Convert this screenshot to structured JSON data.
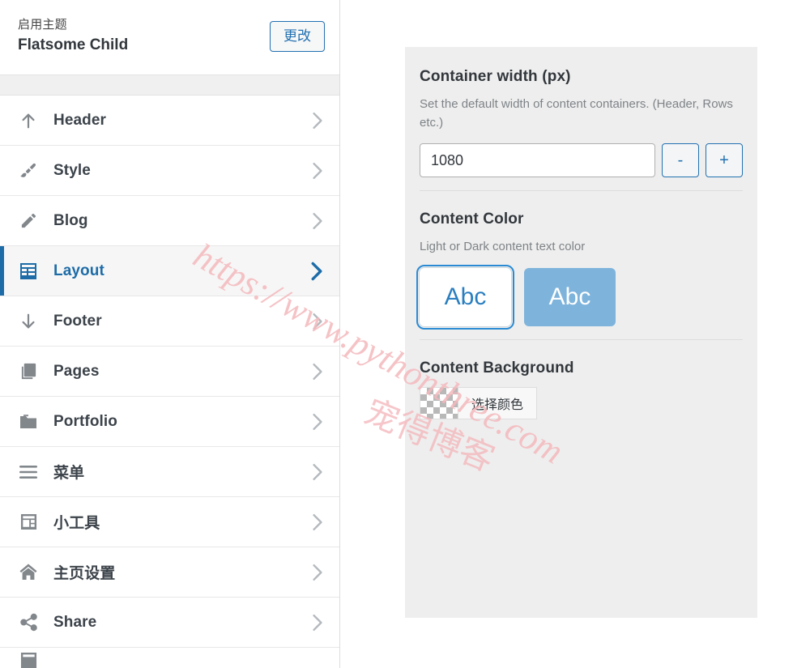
{
  "customizer": {
    "theme_header": {
      "active_label": "启用主题",
      "theme_name": "Flatsome Child",
      "change_button": "更改"
    },
    "menu_items": [
      {
        "label": "Header",
        "icon": "arrow-up-icon",
        "active": false
      },
      {
        "label": "Style",
        "icon": "paint-brush-icon",
        "active": false
      },
      {
        "label": "Blog",
        "icon": "pencil-icon",
        "active": false
      },
      {
        "label": "Layout",
        "icon": "table-grid-icon",
        "active": true
      },
      {
        "label": "Footer",
        "icon": "arrow-down-icon",
        "active": false
      },
      {
        "label": "Pages",
        "icon": "pages-stack-icon",
        "active": false
      },
      {
        "label": "Portfolio",
        "icon": "folder-icon",
        "active": false
      },
      {
        "label": "菜单",
        "icon": "hamburger-icon",
        "active": false
      },
      {
        "label": "小工具",
        "icon": "widgets-icon",
        "active": false
      },
      {
        "label": "主页设置",
        "icon": "home-icon",
        "active": false
      },
      {
        "label": "Share",
        "icon": "share-icon",
        "active": false
      }
    ]
  },
  "settings": {
    "container_width": {
      "title": "Container width (px)",
      "description": "Set the default width of content containers. (Header, Rows etc.)",
      "value": "1080",
      "decrement_label": "-",
      "increment_label": "+"
    },
    "content_color": {
      "title": "Content Color",
      "description": "Light or Dark content text color",
      "options": [
        {
          "label": "Abc",
          "variant": "light",
          "selected": true
        },
        {
          "label": "Abc",
          "variant": "dark",
          "selected": false
        }
      ]
    },
    "content_background": {
      "title": "Content Background",
      "swatch": "transparent",
      "pick_button": "选择颜色"
    }
  },
  "watermark": {
    "url": "https://www.pythonthree.com",
    "text_cn": "宠得博客"
  },
  "colors": {
    "accent_blue": "#2271b1",
    "active_blue": "#1d6ca8",
    "icon_gray": "#82878c",
    "panel_bg": "#eeeeee",
    "swatch_dark": "#7eb4dc",
    "watermark_pink": "#f4b9bd"
  }
}
